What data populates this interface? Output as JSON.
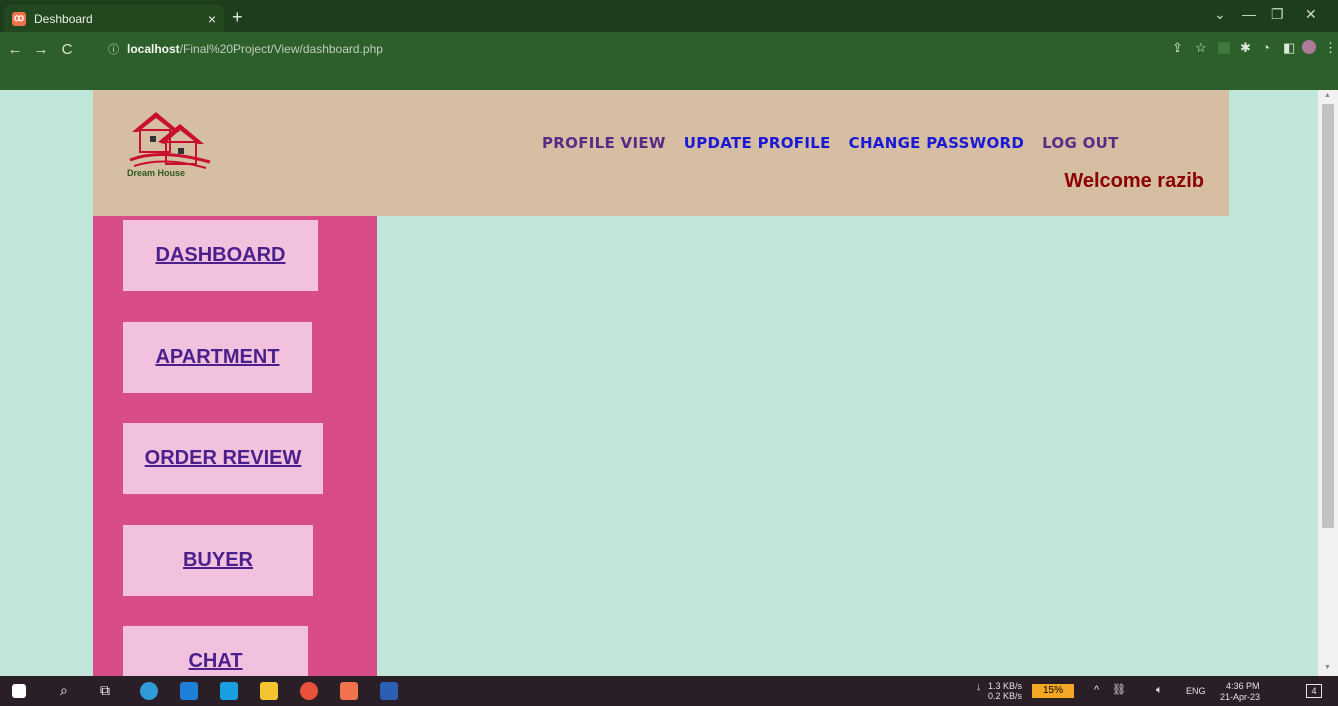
{
  "browser": {
    "tab_title": "Deshboard",
    "tab_close": "×",
    "new_tab": "+",
    "url_host": "localhost",
    "url_path": "/Final%20Project/View/dashboard.php",
    "info_icon": "ⓘ"
  },
  "header": {
    "logo_text": "Dream House",
    "nav": [
      {
        "label": "PROFILE VIEW",
        "color": "#5b2a86"
      },
      {
        "label": "UPDATE PROFILE",
        "color": "#1b18d6"
      },
      {
        "label": "CHANGE PASSWORD",
        "color": "#1b18d6"
      },
      {
        "label": "LOG OUT",
        "color": "#5b2a86"
      }
    ],
    "welcome": "Welcome razib"
  },
  "sidebar": {
    "items": [
      {
        "label": "DASHBOARD"
      },
      {
        "label": "APARTMENT"
      },
      {
        "label": "ORDER REVIEW"
      },
      {
        "label": "BUYER"
      },
      {
        "label": "CHAT"
      }
    ]
  },
  "taskbar": {
    "net_down": "1.3 KB/s",
    "net_up": "0.2 KB/s",
    "battery": "15%",
    "lang": "ENG",
    "time": "4:36 PM",
    "date": "21-Apr-23",
    "notifications": "4"
  },
  "colors": {
    "page_bg": "#c0e6da",
    "header_bg": "#d6bea2",
    "sidebar_bg": "#d84c88",
    "sidebar_button_bg": "#f1c1dd",
    "welcome": "#8b0000"
  }
}
